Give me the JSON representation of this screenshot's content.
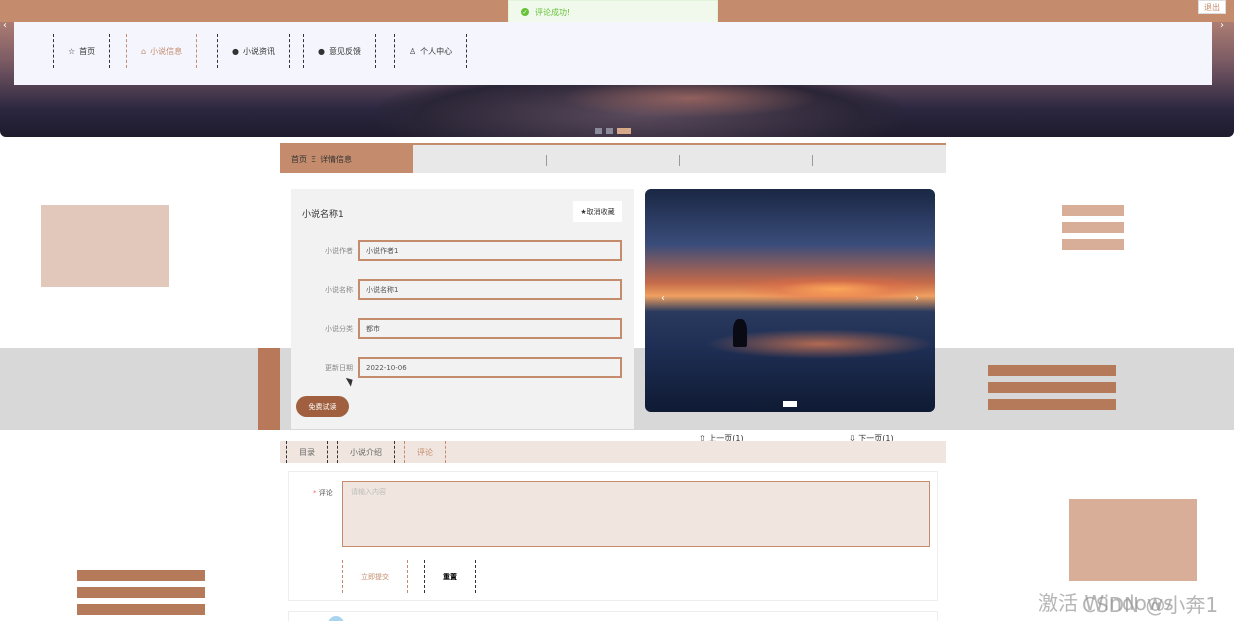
{
  "toast": {
    "text": "评论成功!"
  },
  "topbar": {
    "logout_label": "退出"
  },
  "nav": {
    "items": [
      {
        "label": "首页",
        "icon": "star-icon"
      },
      {
        "label": "小说信息",
        "icon": "lock-icon"
      },
      {
        "label": "小说资讯",
        "icon": "info-icon"
      },
      {
        "label": "意见反馈",
        "icon": "question-icon"
      },
      {
        "label": "个人中心",
        "icon": "user-icon"
      }
    ]
  },
  "breadcrumb": {
    "home": "首页",
    "separator": "Ξ",
    "current": "详情信息"
  },
  "detail": {
    "title": "小说名称1",
    "favorite_label": "★取消收藏",
    "fields": [
      {
        "label": "小说作者",
        "value": "小说作者1"
      },
      {
        "label": "小说名称",
        "value": "小说名称1"
      },
      {
        "label": "小说分类",
        "value": "都市"
      },
      {
        "label": "更新日期",
        "value": "2022-10-06"
      }
    ],
    "trial_button": "免费试读"
  },
  "pager": {
    "prev": "上一页(1)",
    "next": "下一页(1)"
  },
  "tabs": [
    "目录",
    "小说介绍",
    "评论"
  ],
  "comment": {
    "label": "评论",
    "required_mark": "*",
    "placeholder": "请输入内容",
    "submit_label": "立即提交",
    "reset_label": "重置"
  },
  "watermark": {
    "text": "激活 Windows",
    "csdn": "CSDN @小奔1"
  },
  "colors": {
    "accent": "#c48b6d",
    "dark_accent": "#a0603f",
    "success": "#67c23a"
  }
}
